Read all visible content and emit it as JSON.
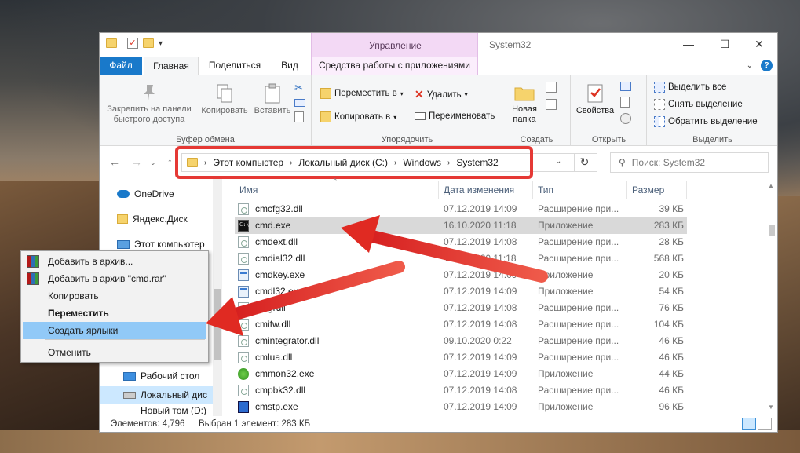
{
  "window": {
    "title": "System32",
    "manage_label": "Управление",
    "minimize": "—",
    "maximize": "☐",
    "close": "✕"
  },
  "tabs": {
    "file": "Файл",
    "home": "Главная",
    "share": "Поделиться",
    "view": "Вид",
    "app_tools": "Средства работы с приложениями"
  },
  "ribbon": {
    "clipboard": {
      "pin": "Закрепить на панели быстрого доступа",
      "copy": "Копировать",
      "paste": "Вставить",
      "label": "Буфер обмена"
    },
    "organize": {
      "move_to": "Переместить в",
      "copy_to": "Копировать в",
      "delete": "Удалить",
      "rename": "Переименовать",
      "label": "Упорядочить"
    },
    "new": {
      "new_folder": "Новая папка",
      "label": "Создать"
    },
    "open": {
      "properties": "Свойства",
      "label": "Открыть"
    },
    "select": {
      "select_all": "Выделить все",
      "select_none": "Снять выделение",
      "invert": "Обратить выделение",
      "label": "Выделить"
    }
  },
  "address": {
    "crumbs": [
      "Этот компьютер",
      "Локальный диск (C:)",
      "Windows",
      "System32"
    ],
    "search_placeholder": "Поиск: System32"
  },
  "navpane": {
    "items": [
      "OneDrive",
      "Яндекс.Диск",
      "Этот компьютер",
      "Рабочий стол",
      "Локальный дис",
      "Новый том (D:)"
    ]
  },
  "columns": {
    "name": "Имя",
    "date": "Дата изменения",
    "type": "Тип",
    "size": "Размер"
  },
  "files": [
    {
      "name": "cmcfg32.dll",
      "date": "07.12.2019 14:09",
      "type": "Расширение при...",
      "size": "39 КБ",
      "icon": "dll"
    },
    {
      "name": "cmd.exe",
      "date": "16.10.2020 11:18",
      "type": "Приложение",
      "size": "283 КБ",
      "icon": "cmd"
    },
    {
      "name": "cmdext.dll",
      "date": "07.12.2019 14:08",
      "type": "Расширение при...",
      "size": "28 КБ",
      "icon": "dll"
    },
    {
      "name": "cmdial32.dll",
      "date": "16.10.2020 11:18",
      "type": "Расширение при...",
      "size": "568 КБ",
      "icon": "dll"
    },
    {
      "name": "cmdkey.exe",
      "date": "07.12.2019 14:09",
      "type": "Приложение",
      "size": "20 КБ",
      "icon": "exe"
    },
    {
      "name": "cmdl32.exe",
      "date": "07.12.2019 14:09",
      "type": "Приложение",
      "size": "54 КБ",
      "icon": "exe"
    },
    {
      "name": "cmgrdll",
      "date": "07.12.2019 14:08",
      "type": "Расширение при...",
      "size": "76 КБ",
      "icon": "dll"
    },
    {
      "name": "cmifw.dll",
      "date": "07.12.2019 14:08",
      "type": "Расширение при...",
      "size": "104 КБ",
      "icon": "dll"
    },
    {
      "name": "cmintegrator.dll",
      "date": "09.10.2020 0:22",
      "type": "Расширение при...",
      "size": "46 КБ",
      "icon": "dll"
    },
    {
      "name": "cmlua.dll",
      "date": "07.12.2019 14:09",
      "type": "Расширение при...",
      "size": "46 КБ",
      "icon": "dll"
    },
    {
      "name": "cmmon32.exe",
      "date": "07.12.2019 14:09",
      "type": "Приложение",
      "size": "44 КБ",
      "icon": "grn"
    },
    {
      "name": "cmpbk32.dll",
      "date": "07.12.2019 14:08",
      "type": "Расширение при...",
      "size": "46 КБ",
      "icon": "dll"
    },
    {
      "name": "cmstp.exe",
      "date": "07.12.2019 14:09",
      "type": "Приложение",
      "size": "96 КБ",
      "icon": "scr"
    }
  ],
  "status": {
    "count": "Элементов: 4,796",
    "selected": "Выбран 1 элемент: 283 КБ"
  },
  "context_menu": {
    "items": [
      {
        "label": "Добавить в архив...",
        "icon": true
      },
      {
        "label": "Добавить в архив \"cmd.rar\"",
        "icon": true
      },
      {
        "label": "Копировать"
      },
      {
        "label": "Переместить",
        "bold": true
      },
      {
        "label": "Создать ярлыки",
        "highlight": true
      },
      {
        "label": "Отменить"
      }
    ]
  },
  "colors": {
    "accent": "#1979ca",
    "manage": "#f3d9f5",
    "annotation_red": "#e53935",
    "selection": "#cce8ff",
    "menu_highlight": "#91c9f7"
  }
}
